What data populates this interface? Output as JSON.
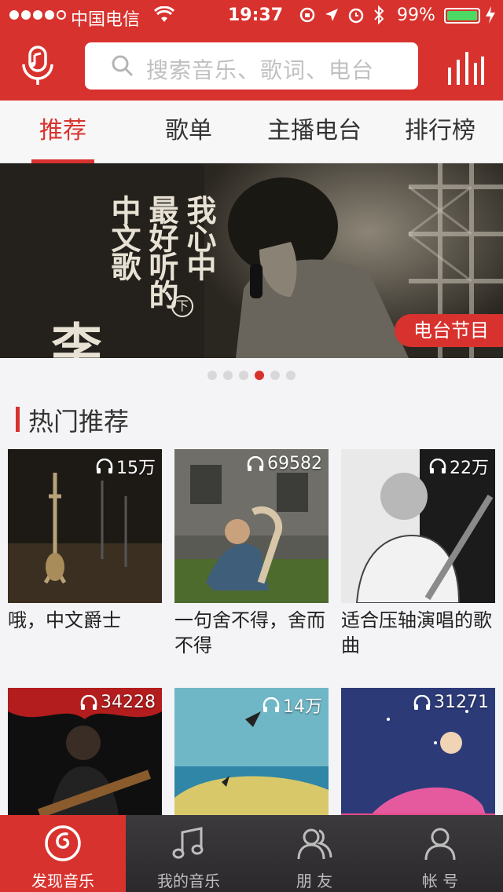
{
  "status_bar": {
    "carrier": "中国电信",
    "time": "19:37",
    "battery": "99%",
    "battery_level": 0.99
  },
  "header": {
    "search_placeholder": "搜索音乐、歌词、电台"
  },
  "tabs": [
    {
      "label": "推荐",
      "active": true
    },
    {
      "label": "歌单",
      "active": false
    },
    {
      "label": "主播电台",
      "active": false
    },
    {
      "label": "排行榜",
      "active": false
    }
  ],
  "banner": {
    "title_big": "李志",
    "title_lines": [
      "我心中",
      "最好听的",
      "中文歌"
    ],
    "title_mark": "下",
    "badge": "电台节目",
    "page_count": 6,
    "active_page": 4
  },
  "section": {
    "title": "热门推荐"
  },
  "playlists": [
    {
      "count": "15万",
      "name": "哦，中文爵士"
    },
    {
      "count": "69582",
      "name": "一句舍不得，舍而不得"
    },
    {
      "count": "22万",
      "name": "适合压轴演唱的歌曲"
    },
    {
      "count": "34228",
      "name": ""
    },
    {
      "count": "14万",
      "name": ""
    },
    {
      "count": "31271",
      "name": ""
    }
  ],
  "bottom_nav": [
    {
      "label": "发现音乐",
      "icon": "netease-music-icon",
      "active": true
    },
    {
      "label": "我的音乐",
      "icon": "music-note-icon",
      "active": false
    },
    {
      "label": "朋 友",
      "icon": "friends-icon",
      "active": false
    },
    {
      "label": "帐 号",
      "icon": "account-icon",
      "active": false
    }
  ],
  "colors": {
    "brand_red": "#d8322e",
    "battery_green": "#4cd964"
  }
}
